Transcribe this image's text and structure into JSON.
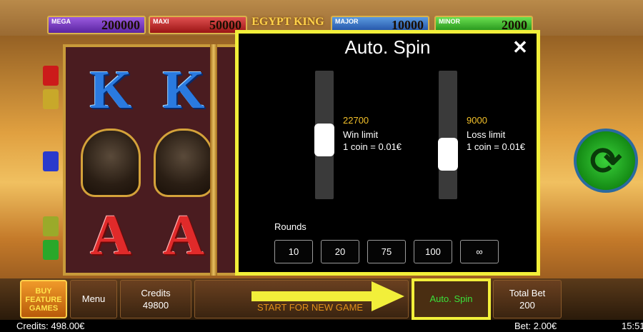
{
  "jackpots": [
    {
      "label": "MEGA",
      "value": "200000"
    },
    {
      "label": "MAXI",
      "value": "50000"
    },
    {
      "label": "MAJOR",
      "value": "10000"
    },
    {
      "label": "MINOR",
      "value": "2000"
    }
  ],
  "logo": "EGYPT KING",
  "reels": {
    "row1": "K",
    "row3": "A"
  },
  "autospin_panel": {
    "title": "Auto. Spin",
    "close_icon": "close-icon",
    "win_limit": {
      "value": "22700",
      "label": "Win limit",
      "coin": "1 coin = 0.01€",
      "level": 0.45
    },
    "loss_limit": {
      "value": "9000",
      "label": "Loss limit",
      "coin": "1 coin = 0.01€",
      "level": 0.3
    },
    "rounds_label": "Rounds",
    "rounds_options": [
      "10",
      "20",
      "75",
      "100",
      "∞"
    ]
  },
  "bottom": {
    "buy_feature": "BUY FEATURE GAMES",
    "menu": "Menu",
    "credits_label": "Credits",
    "credits_value": "49800",
    "start_text": "START FOR NEW GAME",
    "autospin": "Auto. Spin",
    "total_bet_label": "Total Bet",
    "total_bet_value": "200"
  },
  "status": {
    "credits": "Credits: 498.00€",
    "bet": "Bet: 2.00€",
    "time": "15:51"
  },
  "colors": {
    "highlight": "#f2ef3a",
    "limit_value": "#f2c02a",
    "autospin_text": "#3ae03a"
  }
}
